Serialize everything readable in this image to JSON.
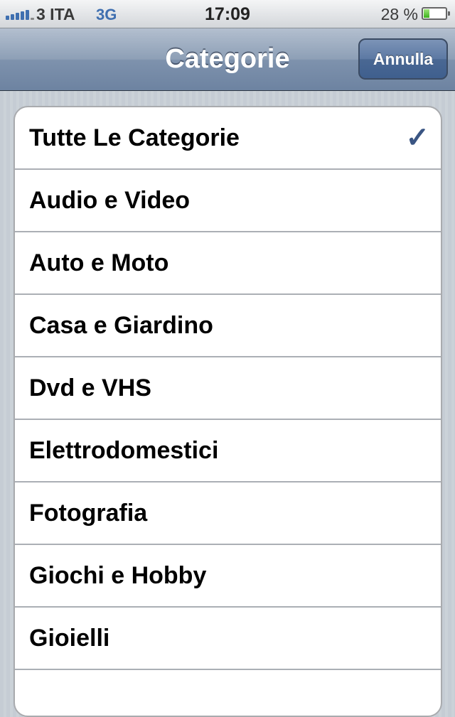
{
  "status_bar": {
    "carrier": "3 ITA",
    "network": "3G",
    "time": "17:09",
    "battery_percent": "28 %",
    "battery_level": 0.28,
    "signal_bars": 5
  },
  "nav": {
    "title": "Categorie",
    "cancel_label": "Annulla"
  },
  "categories": [
    {
      "label": "Tutte Le Categorie",
      "selected": true
    },
    {
      "label": "Audio e Video"
    },
    {
      "label": "Auto e Moto"
    },
    {
      "label": "Casa e Giardino"
    },
    {
      "label": "Dvd e VHS"
    },
    {
      "label": "Elettrodomestici"
    },
    {
      "label": "Fotografia"
    },
    {
      "label": "Giochi e Hobby"
    },
    {
      "label": "Gioielli"
    },
    {
      "label": ""
    }
  ],
  "icons": {
    "checkmark": "checkmark-icon"
  },
  "colors": {
    "nav_bar": "#7e92ad",
    "accent": "#3a5583",
    "background": "#c5ccd4"
  }
}
